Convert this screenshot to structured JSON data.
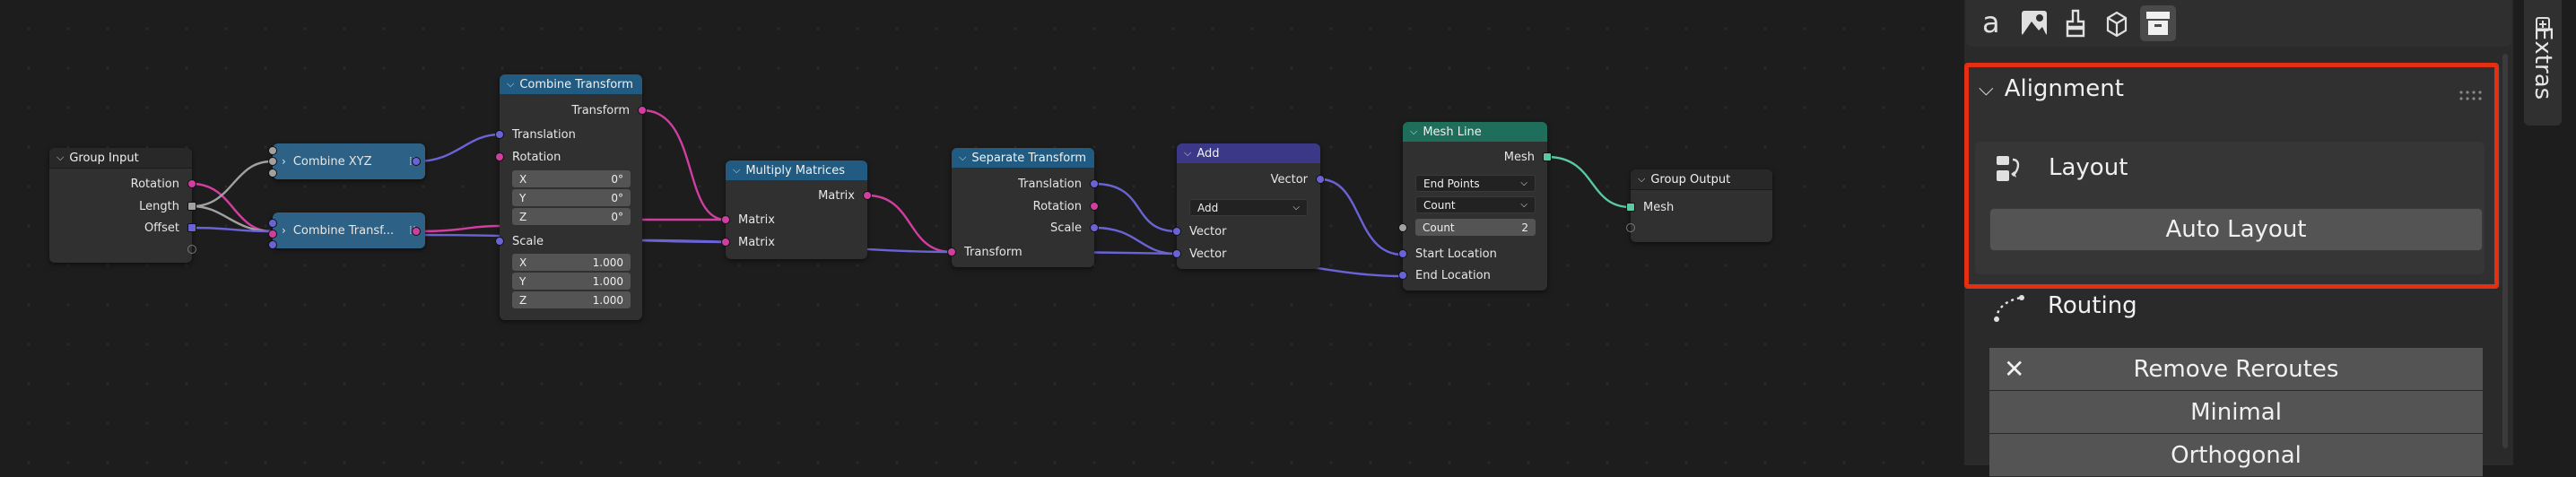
{
  "nodes": {
    "group_input": {
      "title": "Group Input",
      "outputs": [
        "Rotation",
        "Length",
        "Offset"
      ]
    },
    "combine_xyz": {
      "title": "Combine XYZ",
      "badge": "⁞⁞"
    },
    "combine_transform_collapsed": {
      "title": "Combine Transf...",
      "badge": "⁞⁞"
    },
    "combine_transform": {
      "title": "Combine Transform",
      "output": "Transform",
      "translation": "Translation",
      "rotation": "Rotation",
      "rot_fields": [
        {
          "axis": "X",
          "value": "0°"
        },
        {
          "axis": "Y",
          "value": "0°"
        },
        {
          "axis": "Z",
          "value": "0°"
        }
      ],
      "scale": "Scale",
      "scale_fields": [
        {
          "axis": "X",
          "value": "1.000"
        },
        {
          "axis": "Y",
          "value": "1.000"
        },
        {
          "axis": "Z",
          "value": "1.000"
        }
      ]
    },
    "multiply_matrices": {
      "title": "Multiply Matrices",
      "output": "Matrix",
      "inputs": [
        "Matrix",
        "Matrix"
      ]
    },
    "separate_transform": {
      "title": "Separate Transform",
      "outputs": [
        "Translation",
        "Rotation",
        "Scale"
      ],
      "input": "Transform"
    },
    "add": {
      "title": "Add",
      "output": "Vector",
      "operation": "Add",
      "inputs": [
        "Vector",
        "Vector"
      ]
    },
    "mesh_line": {
      "title": "Mesh Line",
      "output": "Mesh",
      "mode": "End Points",
      "count_mode": "Count",
      "count_label": "Count",
      "count_value": "2",
      "inputs": [
        "Start Location",
        "End Location"
      ]
    },
    "group_output": {
      "title": "Group Output",
      "input": "Mesh"
    }
  },
  "sidebar": {
    "tools": [
      "text-icon",
      "image-icon",
      "paint-icon",
      "cube-icon",
      "archive-icon"
    ],
    "alignment": {
      "title": "Alignment",
      "layout_label": "Layout",
      "auto_layout": "Auto Layout",
      "routing_label": "Routing",
      "buttons": [
        "Remove Reroutes",
        "Minimal",
        "Orthogonal"
      ]
    },
    "tab": "Extras"
  },
  "colors": {
    "vector": "#6a63d6",
    "matrix": "#d03ea0",
    "float": "#a1a1a1",
    "geometry": "#5ac8a0",
    "highlight": "#e52f12"
  }
}
